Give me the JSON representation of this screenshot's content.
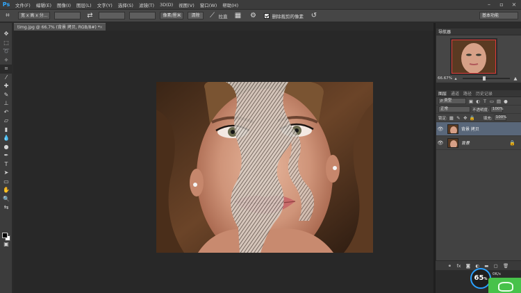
{
  "app": {
    "logo": "Ps"
  },
  "menu": [
    "文件(F)",
    "编辑(E)",
    "图像(I)",
    "图层(L)",
    "文字(Y)",
    "选择(S)",
    "滤镜(T)",
    "3D(D)",
    "视图(V)",
    "窗口(W)",
    "帮助(H)"
  ],
  "window_controls": {
    "minimize": "–",
    "restore": "▫",
    "close": "×"
  },
  "options": {
    "tool_icon": "crop-icon",
    "ratio_select": "宽 x 高 x 分...",
    "swap_icon": "⇄",
    "unit_select": "像素/厘米",
    "clear_button": "清除",
    "straighten_label": "拉直",
    "delete_cropped_label": "删除裁剪的像素",
    "delete_cropped_checked": true,
    "workspace": "基本功能"
  },
  "document": {
    "tab_title": "timg.jpg @ 66.7% (背景 拷贝, RGB/8#) *",
    "close": "×"
  },
  "navigator": {
    "tabs": [
      "导航器"
    ],
    "zoom": "66.67%",
    "zoom_level": 0.42
  },
  "layers_panel": {
    "tabs": [
      "图层",
      "通道",
      "路径",
      "历史记录"
    ],
    "filter_label": "ρ 类型",
    "blend_mode": "正常",
    "opacity_label": "不透明度:",
    "opacity": "100%",
    "lock_label": "锁定:",
    "fill_label": "填充:",
    "fill": "100%",
    "layers": [
      {
        "name": "背景 拷贝",
        "selected": true,
        "locked": false
      },
      {
        "name": "背景",
        "selected": false,
        "locked": true
      }
    ]
  },
  "status": {
    "meter_value": "65",
    "meter_unit": "%",
    "net_speed": "0K/s"
  },
  "colors": {
    "accent": "#31a8ff",
    "selected_layer": "#59677a",
    "nav_frame": "#e03a3a",
    "widget_green": "#47c24a"
  }
}
